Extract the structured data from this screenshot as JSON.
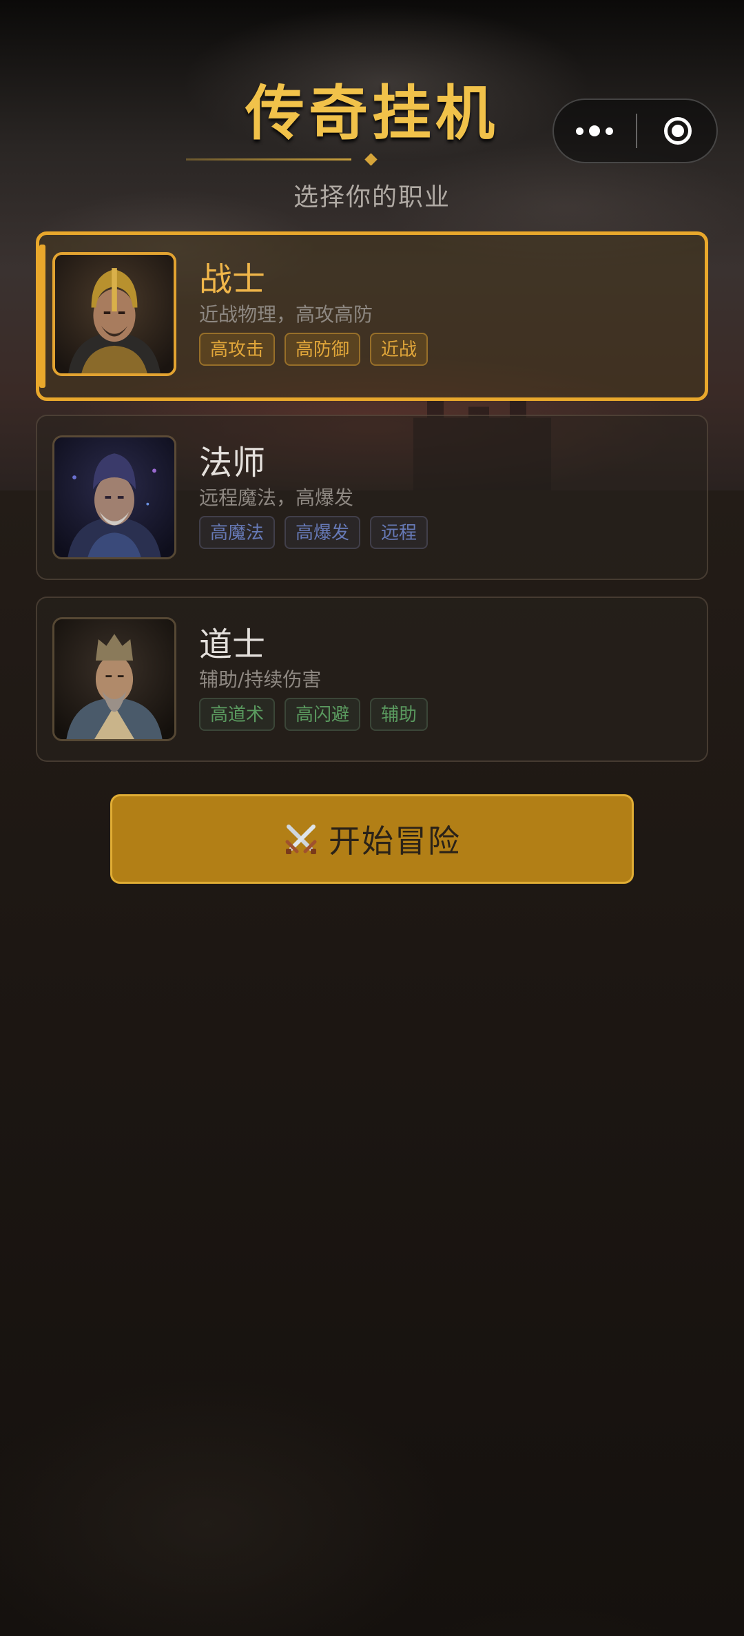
{
  "header": {
    "title": "传奇挂机",
    "subtitle": "选择你的职业"
  },
  "capsule": {
    "more_icon": "more-dots-icon",
    "close_icon": "target-circle-icon"
  },
  "classes": [
    {
      "name": "战士",
      "description": "近战物理，高攻高防",
      "tags": [
        "高攻击",
        "高防御",
        "近战"
      ],
      "tag_color": "#e2a73a",
      "selected": true,
      "portrait": "warrior-portrait"
    },
    {
      "name": "法师",
      "description": "远程魔法，高爆发",
      "tags": [
        "高魔法",
        "高爆发",
        "远程"
      ],
      "tag_color": "#6679b6",
      "selected": false,
      "portrait": "mage-portrait"
    },
    {
      "name": "道士",
      "description": "辅助/持续伤害",
      "tags": [
        "高道术",
        "高闪避",
        "辅助"
      ],
      "tag_color": "#5a9a5f",
      "selected": false,
      "portrait": "taoist-portrait"
    }
  ],
  "start_button": {
    "icon": "crossed-swords-icon",
    "label": "开始冒险"
  },
  "colors": {
    "accent": "#e9a82c",
    "title": "#f1c24a",
    "button": "#b27f16"
  }
}
